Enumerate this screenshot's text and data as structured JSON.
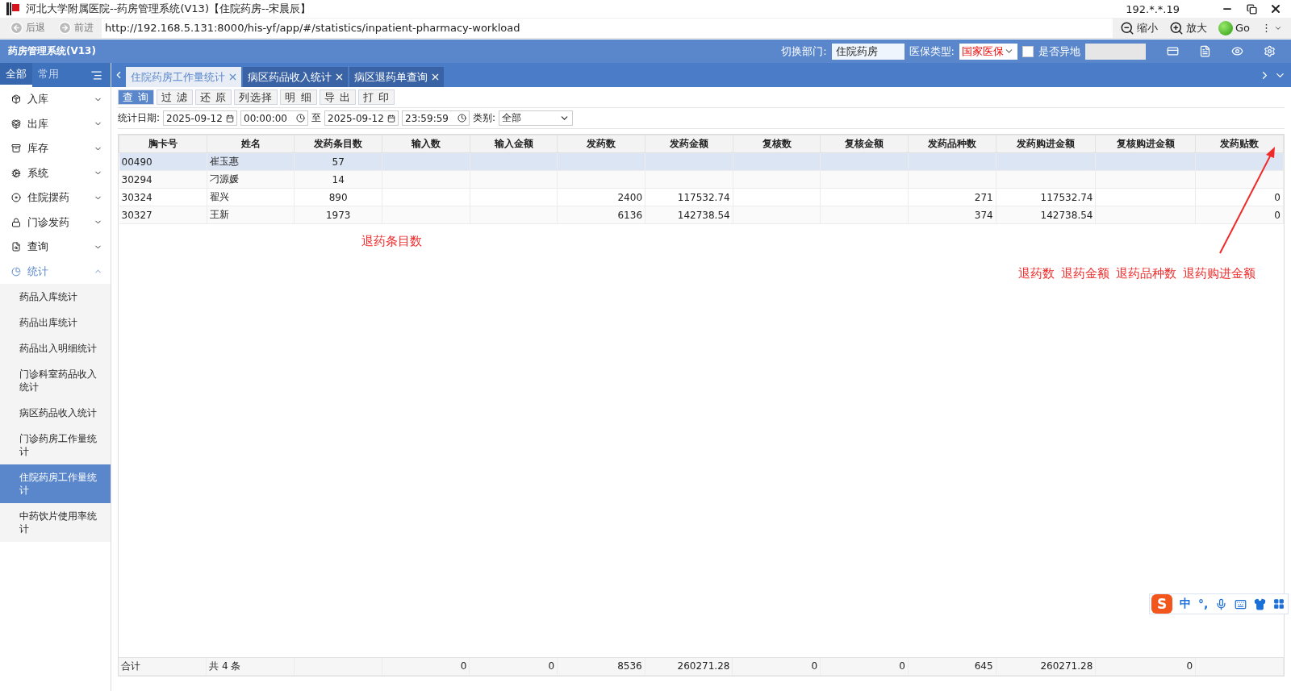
{
  "window": {
    "title": "河北大学附属医院--药房管理系统(V13)【住院药房--宋晨辰】",
    "ip": "192.*.*.19"
  },
  "browser": {
    "back": "后退",
    "forward": "前进",
    "url": "http://192.168.5.131:8000/his-yf/app/#/statistics/inpatient-pharmacy-workload",
    "zoom_out": "缩小",
    "zoom_in": "放大",
    "go": "Go",
    "more": "⋮"
  },
  "header": {
    "app_name": "药房管理系统(V13)",
    "dept_label": "切换部门:",
    "dept_value": "住院药房",
    "insurance_label": "医保类型:",
    "insurance_value": "国家医保",
    "remote_label": "是否异地",
    "remote_checked": false
  },
  "sidebar": {
    "tabs": [
      {
        "label": "全部",
        "selected": true
      },
      {
        "label": "常用",
        "selected": false
      }
    ],
    "items": [
      {
        "label": "入库",
        "expanded": false
      },
      {
        "label": "出库",
        "expanded": false
      },
      {
        "label": "库存",
        "expanded": false
      },
      {
        "label": "系统",
        "expanded": false
      },
      {
        "label": "住院摆药",
        "expanded": false
      },
      {
        "label": "门诊发药",
        "expanded": false
      },
      {
        "label": "查询",
        "expanded": false
      },
      {
        "label": "统计",
        "expanded": true,
        "children": [
          {
            "label": "药品入库统计",
            "selected": false
          },
          {
            "label": "药品出库统计",
            "selected": false
          },
          {
            "label": "药品出入明细统计",
            "selected": false
          },
          {
            "label": "门诊科室药品收入统计",
            "selected": false
          },
          {
            "label": "病区药品收入统计",
            "selected": false
          },
          {
            "label": "门诊药房工作量统计",
            "selected": false
          },
          {
            "label": "住院药房工作量统计",
            "selected": true
          },
          {
            "label": "中药饮片使用率统计",
            "selected": false
          }
        ]
      }
    ]
  },
  "tabs": [
    {
      "label": "住院药房工作量统计",
      "selected": true
    },
    {
      "label": "病区药品收入统计",
      "selected": false
    },
    {
      "label": "病区退药单查询",
      "selected": false
    }
  ],
  "toolbar": [
    "查 询",
    "过 滤",
    "还 原",
    "列选择",
    "明 细",
    "导 出",
    "打 印"
  ],
  "filters": {
    "date_label": "统计日期:",
    "start_date": "2025-09-12",
    "start_time": "00:00:00",
    "to": "至",
    "end_date": "2025-09-12",
    "end_time": "23:59:59",
    "category_label": "类别:",
    "category_value": "全部"
  },
  "table": {
    "columns": [
      "胸卡号",
      "姓名",
      "发药条目数",
      "输入数",
      "输入金额",
      "发药数",
      "发药金额",
      "复核数",
      "复核金额",
      "发药品种数",
      "发药购进金额",
      "复核购进金额",
      "发药贴数"
    ],
    "rows": [
      {
        "selected": true,
        "cells": [
          "00490",
          "崔玉惠",
          "57",
          null,
          null,
          null,
          null,
          null,
          null,
          null,
          null,
          null,
          null
        ]
      },
      {
        "selected": false,
        "cells": [
          "30294",
          "刁源媛",
          "14",
          null,
          null,
          null,
          null,
          null,
          null,
          null,
          null,
          null,
          null
        ]
      },
      {
        "selected": false,
        "cells": [
          "30324",
          "翟兴",
          "890",
          null,
          null,
          "2400",
          "117532.74",
          null,
          null,
          "271",
          "117532.74",
          null,
          "0"
        ]
      },
      {
        "selected": false,
        "cells": [
          "30327",
          "王新",
          "1973",
          null,
          null,
          "6136",
          "142738.54",
          null,
          null,
          "374",
          "142738.54",
          null,
          "0"
        ]
      }
    ],
    "footer": {
      "label": "合计",
      "count": "共 4 条",
      "totals": [
        "0",
        "0",
        "8536",
        "260271.28",
        "0",
        "0",
        "645",
        "260271.28",
        "0"
      ]
    }
  },
  "annotations": {
    "header_note": "退药条目数",
    "notes": [
      "退药数",
      "退药金额",
      "退药品种数",
      "退药购进金额"
    ]
  },
  "ime": {
    "logo": "S",
    "mode": "中",
    "punct": "°,"
  }
}
